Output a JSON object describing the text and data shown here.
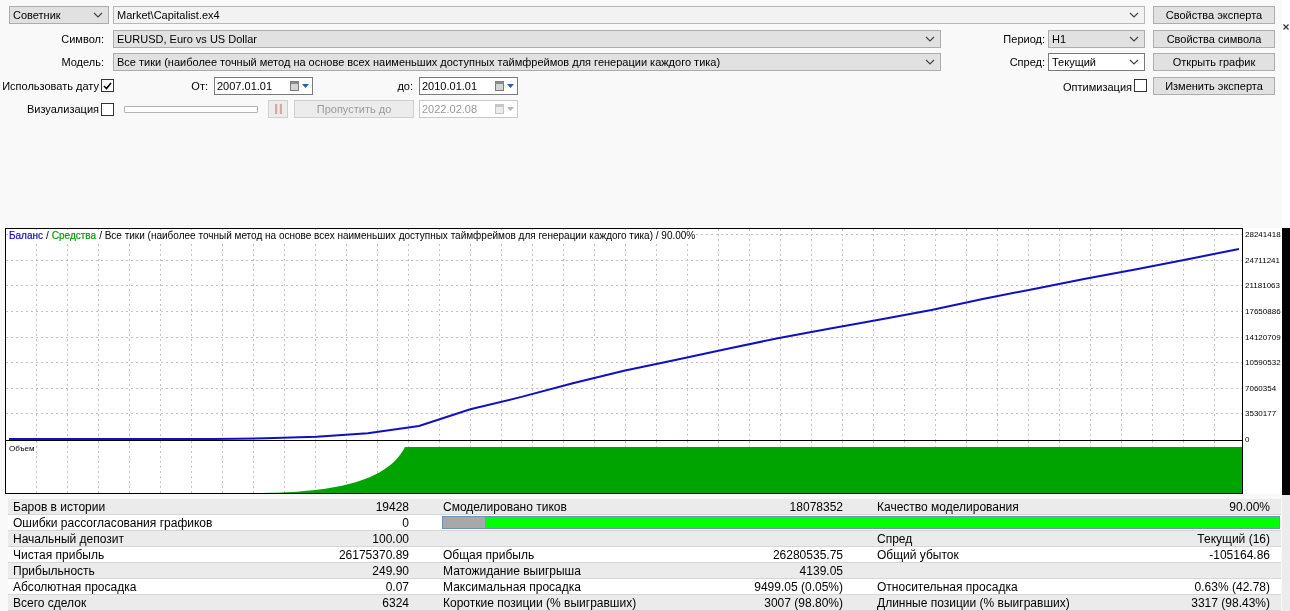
{
  "mode_select": {
    "value": "Советник"
  },
  "expert_select": {
    "value": "Market\\Capitalist.ex4"
  },
  "buttons": [
    "Свойства эксперта",
    "Свойства символа",
    "Открыть график",
    "Изменить эксперта"
  ],
  "symbol": {
    "label": "Символ:",
    "value": "EURUSD, Euro vs US Dollar"
  },
  "period": {
    "label": "Период:",
    "value": "H1"
  },
  "model": {
    "label": "Модель:",
    "value": "Все тики (наиболее точный метод на основе всех наименьших доступных таймфреймов для генерации каждого тика)"
  },
  "spread": {
    "label": "Спред:",
    "value": "Текущий"
  },
  "use_date": {
    "label": "Использовать дату",
    "checked": true
  },
  "from_date": {
    "label": "От:",
    "value": "2007.01.01"
  },
  "to_date": {
    "label": "до:",
    "value": "2010.01.01"
  },
  "optimization": {
    "label": "Оптимизация",
    "checked": false
  },
  "visualization": {
    "label": "Визуализация",
    "checked": false
  },
  "pause_button": {
    "disabled": true
  },
  "skip_button": {
    "label": "Пропустить до",
    "disabled": true
  },
  "skip_date": {
    "value": "2022.02.08",
    "disabled": true
  },
  "chart": {
    "header": [
      {
        "text": "/"
      },
      {
        "text": "Средства",
        "color": "#00a000"
      },
      {
        "text": "/ Все тики (наиболее точный метод на основе всех наименьших доступных таймфреймов для генерации каждого тика) / 90.00%"
      }
    ],
    "volume_label": "Объем",
    "chart_data": {
      "type": "line",
      "series": [
        {
          "name": "Баланс",
          "color": "#1010c0",
          "values": [
            0,
            0,
            0,
            0,
            0,
            100000,
            300000,
            800000,
            1800000,
            4100000,
            5800000,
            7700000,
            9400000,
            10900000,
            12400000,
            13900000,
            15200000,
            16500000,
            17800000,
            19300000,
            20700000,
            22100000,
            23400000,
            24800000,
            26200000
          ]
        }
      ],
      "ylim": [
        0,
        28960000
      ],
      "yticks": [
        0,
        3530177,
        7060354,
        10590532,
        14120709,
        17650886,
        21181063,
        24711241,
        28241418
      ],
      "grid": true
    }
  },
  "stats": {
    "rows": [
      {
        "kind": "values",
        "cells": [
          {
            "label": "Баров в истории",
            "value": "19428"
          },
          {
            "label": "Смоделировано тиков",
            "value": "18078352"
          },
          {
            "label": "Качество моделирования",
            "value": "90.00%"
          }
        ]
      },
      {
        "kind": "quality",
        "cells": [
          {
            "label": "Ошибки рассогласования графиков",
            "value": "0"
          }
        ],
        "level": 0.95
      },
      {
        "kind": "values",
        "cells": [
          {
            "label": "Начальный депозит",
            "value": "100.00"
          },
          null,
          {
            "label": "Спред",
            "value": "Текущий (16)"
          }
        ]
      },
      {
        "kind": "values",
        "cells": [
          {
            "label": "Чистая прибыль",
            "value": "26175370.89"
          },
          {
            "label": "Общая прибыль",
            "value": "26280535.75"
          },
          {
            "label": "Общий убыток",
            "value": "-105164.86"
          }
        ]
      },
      {
        "kind": "values",
        "cells": [
          {
            "label": "Прибыльность",
            "value": "249.90"
          },
          {
            "label": "Матожидание выигрыша",
            "value": "4139.05"
          },
          null
        ]
      },
      {
        "kind": "values",
        "cells": [
          {
            "label": "Абсолютная просадка",
            "value": "0.07"
          },
          {
            "label": "Максимальная просадка",
            "value": "9499.05 (0.05%)"
          },
          {
            "label": "Относительная просадка",
            "value": "0.63% (42.78)"
          }
        ]
      },
      {
        "kind": "values",
        "cells": [
          {
            "label": "Всего сделок",
            "value": "6324"
          },
          {
            "label": "Короткие позиции (% выигравших)",
            "value": "3007 (98.80%)"
          },
          {
            "label": "Длинные позиции (% выигравших)",
            "value": "3317 (98.43%)"
          }
        ]
      }
    ]
  }
}
